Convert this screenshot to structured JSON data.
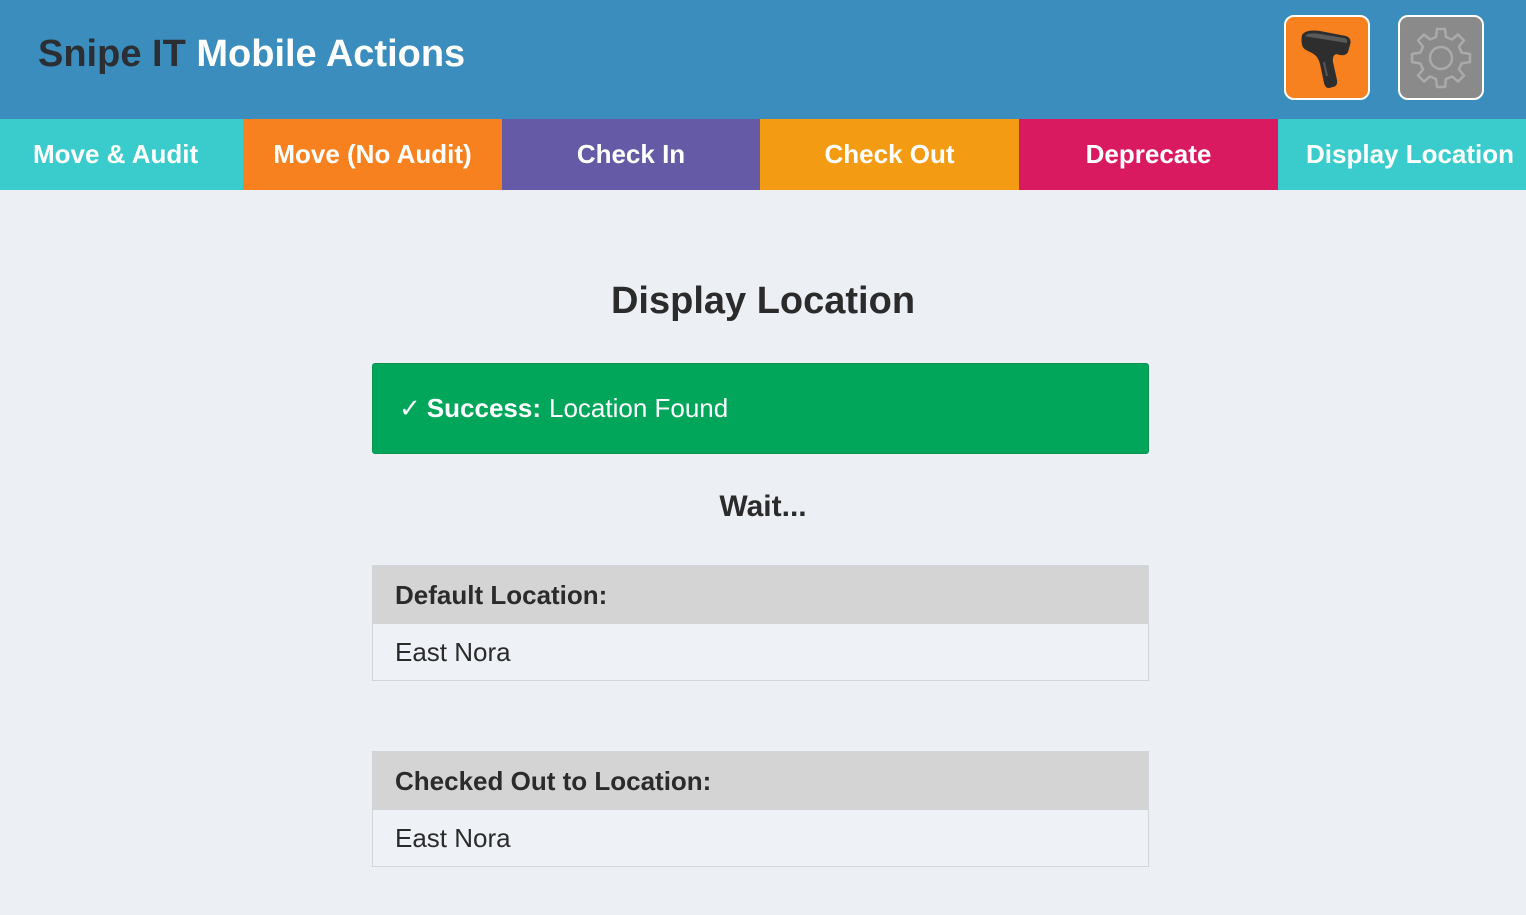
{
  "header": {
    "title_part1": "Snipe IT",
    "title_part2": "Mobile Actions",
    "scanner_icon": "barcode-scanner-icon",
    "settings_icon": "gear-icon"
  },
  "tabs": [
    {
      "label": "Move & Audit",
      "color": "#3acccc"
    },
    {
      "label": "Move (No Audit)",
      "color": "#f7811e"
    },
    {
      "label": "Check In",
      "color": "#645aa6"
    },
    {
      "label": "Check Out",
      "color": "#f49b14"
    },
    {
      "label": "Deprecate",
      "color": "#da1a60"
    },
    {
      "label": "Display Location",
      "color": "#3acccc"
    }
  ],
  "main": {
    "heading": "Display Location",
    "alert": {
      "check": "✓",
      "label": "Success:",
      "message": "Location Found",
      "color": "#01a65b"
    },
    "status": "Wait...",
    "default_location": {
      "label": "Default Location:",
      "value": "East Nora"
    },
    "checked_out_location": {
      "label": "Checked Out to Location:",
      "value": "East Nora"
    }
  }
}
